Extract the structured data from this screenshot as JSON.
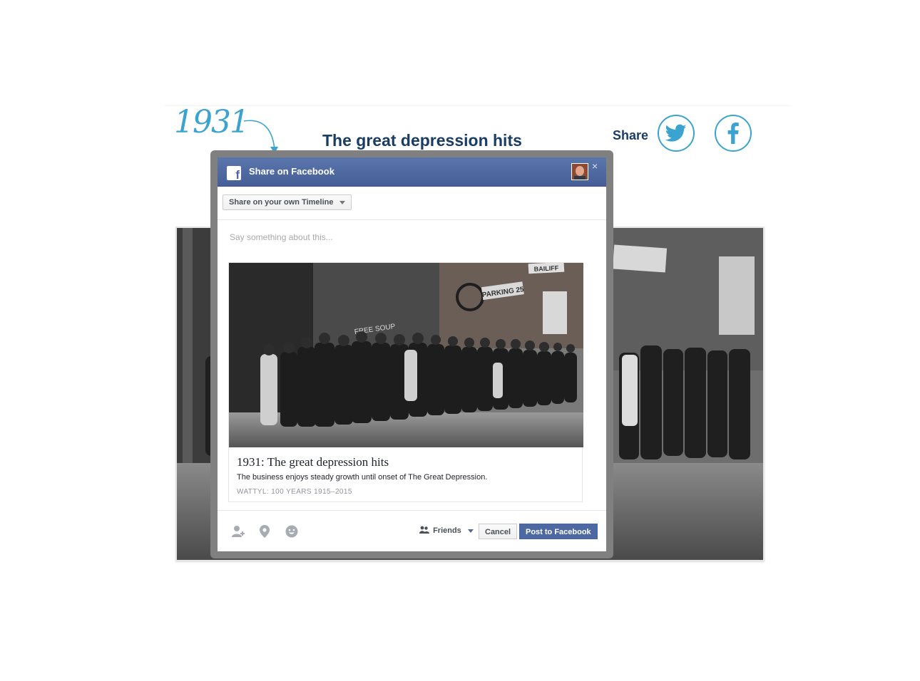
{
  "page": {
    "year": "1931",
    "headline": "The great depression hits",
    "share_label": "Share",
    "social": [
      {
        "name": "twitter",
        "icon": "twitter-bird-icon"
      },
      {
        "name": "facebook",
        "icon": "facebook-f-icon"
      }
    ],
    "accent_color": "#3ba3cf",
    "headline_color": "#1a3d66"
  },
  "photo": {
    "sign_free_soup": "FREE SOUP",
    "sign_parking": "PARKING 25",
    "sign_bailiff": "BAILIFF"
  },
  "dialog": {
    "title": "Share on Facebook",
    "close_glyph": "×",
    "audience_select": "Share on your own Timeline",
    "message_placeholder": "Say something about this...",
    "preview": {
      "title": "1931: The great depression hits",
      "description": "The business enjoys steady growth until onset of The Great Depression.",
      "caption": "WATTYL: 100 YEARS 1915–2015"
    },
    "footer": {
      "icons": [
        "tag-friends-icon",
        "location-pin-icon",
        "emoji-icon"
      ],
      "privacy": "Friends",
      "cancel": "Cancel",
      "post": "Post to Facebook"
    },
    "header_color": "#4e69a2"
  }
}
